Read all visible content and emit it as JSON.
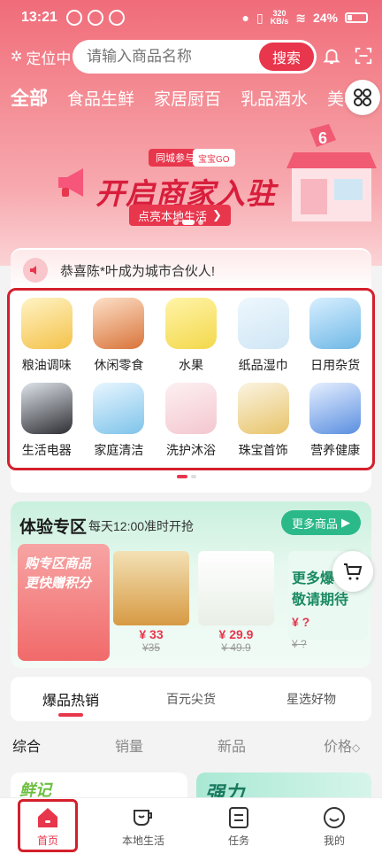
{
  "status_bar": {
    "time": "13:21",
    "net_speed_top": "320",
    "net_speed_bottom": "KB/s",
    "battery": "24%"
  },
  "header": {
    "location_label": "定位中",
    "search_placeholder": "请输入商品名称",
    "search_button": "搜索"
  },
  "category_tabs": [
    "全部",
    "食品生鲜",
    "家居厨百",
    "乳品酒水",
    "美妆"
  ],
  "banner": {
    "tag1": "同城参与",
    "tag2": "宝宝GO",
    "title": "开启商家入驻",
    "subtitle": "点亮本地生活",
    "badge_number": "6"
  },
  "notice": {
    "text": "恭喜陈*叶成为城市合伙人!"
  },
  "categories": [
    {
      "label": "粮油调味",
      "icon": "cooking-oil-icon",
      "color": "#f4c24a"
    },
    {
      "label": "休闲零食",
      "icon": "snacks-icon",
      "color": "#d9743a"
    },
    {
      "label": "水果",
      "icon": "fruit-basket-icon",
      "color": "#f3d84c"
    },
    {
      "label": "纸品湿巾",
      "icon": "tissue-icon",
      "color": "#cfe6f5"
    },
    {
      "label": "日用杂货",
      "icon": "groceries-icon",
      "color": "#6fb8e6"
    },
    {
      "label": "生活电器",
      "icon": "appliance-icon",
      "color": "#2e2e33"
    },
    {
      "label": "家庭清洁",
      "icon": "cleaning-icon",
      "color": "#7ec3ea"
    },
    {
      "label": "洗护沐浴",
      "icon": "shower-gel-icon",
      "color": "#f3c7cf"
    },
    {
      "label": "珠宝首饰",
      "icon": "jewelry-icon",
      "color": "#e8c46a"
    },
    {
      "label": "营养健康",
      "icon": "nutrition-icon",
      "color": "#5a8fe0"
    }
  ],
  "experience": {
    "title": "体验专区",
    "subtitle": "每天12:00准时开抢",
    "more_button": "更多商品",
    "promo_line1": "购专区商品",
    "promo_line2": "更快赠积分",
    "products": [
      {
        "price": "¥ 33",
        "old_price": "¥35",
        "tag": "33"
      },
      {
        "price": "¥ 29.9",
        "old_price": "¥ 49.9",
        "tag": "29.9"
      }
    ],
    "coming_soon_line1": "更多爆",
    "coming_soon_line2": "敬请期待",
    "coming_soon_price": "¥ ?",
    "coming_soon_old": "¥ ?"
  },
  "section_tabs": [
    "爆品热销",
    "百元尖货",
    "星选好物"
  ],
  "sort_options": {
    "overall": "综合",
    "sales": "销量",
    "new": "新品",
    "price": "价格"
  },
  "feed": {
    "brand1": "鲜记",
    "brand2": "强力"
  },
  "bottom_nav": [
    {
      "label": "首页",
      "icon": "home-icon"
    },
    {
      "label": "本地生活",
      "icon": "cup-icon"
    },
    {
      "label": "任务",
      "icon": "task-icon"
    },
    {
      "label": "我的",
      "icon": "smile-icon"
    }
  ],
  "colors": {
    "accent": "#e8364c",
    "green": "#2bb98a",
    "highlight": "#d4202c"
  }
}
